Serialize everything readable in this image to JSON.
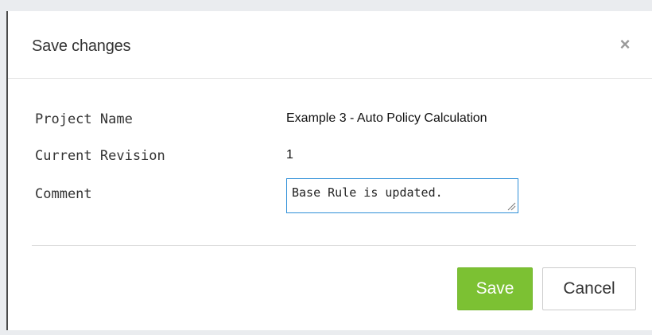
{
  "dialog": {
    "title": "Save changes",
    "close_symbol": "×",
    "close_icon": "close-icon"
  },
  "fields": {
    "project_name": {
      "label": "Project Name",
      "value": "Example 3 - Auto Policy Calculation"
    },
    "current_revision": {
      "label": "Current Revision",
      "value": "1"
    },
    "comment": {
      "label": "Comment",
      "value": "Base Rule is updated."
    }
  },
  "buttons": {
    "save_label": "Save",
    "cancel_label": "Cancel"
  },
  "colors": {
    "save_bg": "#7cc133",
    "focus_border": "#2f8fd8"
  }
}
